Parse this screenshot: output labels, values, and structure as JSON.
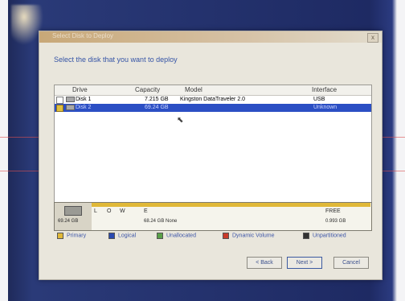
{
  "window": {
    "title": "Select Disk to Deploy",
    "close_glyph": "x"
  },
  "prompt": "Select the disk that you want to deploy",
  "columns": {
    "drive": "Drive",
    "capacity": "Capacity",
    "model": "Model",
    "interface": "Interface"
  },
  "disks": [
    {
      "drive": "Disk 1",
      "capacity": "7.215 GB",
      "model": "Kingston DataTraveler 2.0",
      "interface": "USB",
      "selected": false
    },
    {
      "drive": "Disk 2",
      "capacity": "69.24 GB",
      "model": "",
      "interface": "Unknown",
      "selected": true
    }
  ],
  "disk_map": {
    "disk_label": "69.24 GB",
    "partitions": [
      {
        "letter": "L",
        "desc": ""
      },
      {
        "letter": "O",
        "desc": ""
      },
      {
        "letter": "W",
        "desc": ""
      },
      {
        "letter": "E",
        "desc": "68.24 GB None"
      },
      {
        "letter": "FREE",
        "desc": "0.993 GB"
      }
    ]
  },
  "legend": [
    {
      "label": "Primary",
      "color": "#e0b838"
    },
    {
      "label": "Logical",
      "color": "#2a4ab0"
    },
    {
      "label": "Unallocated",
      "color": "#5aa048"
    },
    {
      "label": "Dynamic Volume",
      "color": "#c83a2a"
    },
    {
      "label": "Unpartitioned",
      "color": "#333333"
    }
  ],
  "buttons": {
    "back": "< Back",
    "next": "Next >",
    "cancel": "Cancel"
  },
  "cursor_glyph": "⬉"
}
